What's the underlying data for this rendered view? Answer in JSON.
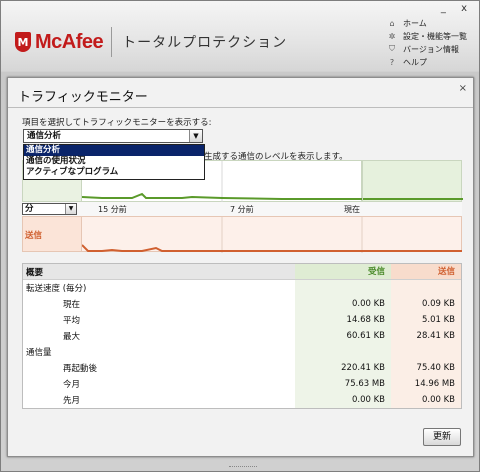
{
  "window": {
    "controls": "_ x"
  },
  "brand": {
    "logo_letter": "M",
    "name": "McAfee",
    "product": "トータルプロテクション"
  },
  "topnav": {
    "items": [
      {
        "icon": "home-icon",
        "glyph": "⌂",
        "label": "ホーム"
      },
      {
        "icon": "gear-icon",
        "glyph": "✲",
        "label": "設定・機能等一覧"
      },
      {
        "icon": "shield-icon",
        "glyph": "⛉",
        "label": "バージョン情報"
      },
      {
        "icon": "help-icon",
        "glyph": "?",
        "label": "ヘルプ"
      }
    ]
  },
  "dialog": {
    "title": "トラフィックモニター",
    "close": "×",
    "instruction": "項目を選択してトラフィックモニターを表示する:",
    "select_value": "通信分析",
    "options": [
      "通信分析",
      "通信の使用状況",
      "アクティブなプログラム"
    ],
    "description_tail": "生成する通信のレベルを表示します。",
    "unit_select": "分",
    "ticks": [
      "15 分前",
      "7 分前",
      "現在"
    ],
    "send_label": "送信",
    "refresh_label": "更新"
  },
  "table": {
    "headers": {
      "label": "概要",
      "recv": "受信",
      "send": "送信"
    },
    "rows": [
      {
        "label": "転送速度 (毎分)",
        "recv": "",
        "send": "",
        "indent": false
      },
      {
        "label": "現在",
        "recv": "0.00 KB",
        "send": "0.09 KB",
        "indent": true
      },
      {
        "label": "平均",
        "recv": "14.68 KB",
        "send": "5.01 KB",
        "indent": true
      },
      {
        "label": "最大",
        "recv": "60.61 KB",
        "send": "28.41 KB",
        "indent": true
      },
      {
        "label": "通信量",
        "recv": "",
        "send": "",
        "indent": false
      },
      {
        "label": "再起動後",
        "recv": "220.41 KB",
        "send": "75.40 KB",
        "indent": true
      },
      {
        "label": "今月",
        "recv": "75.63 MB",
        "send": "14.96 MB",
        "indent": true
      },
      {
        "label": "先月",
        "recv": "0.00 KB",
        "send": "0.00 KB",
        "indent": true
      }
    ]
  },
  "colors": {
    "brand_red": "#c21b1b",
    "recv_line": "#5a9a2a",
    "send_line": "#d06030",
    "selection": "#0a246a"
  }
}
